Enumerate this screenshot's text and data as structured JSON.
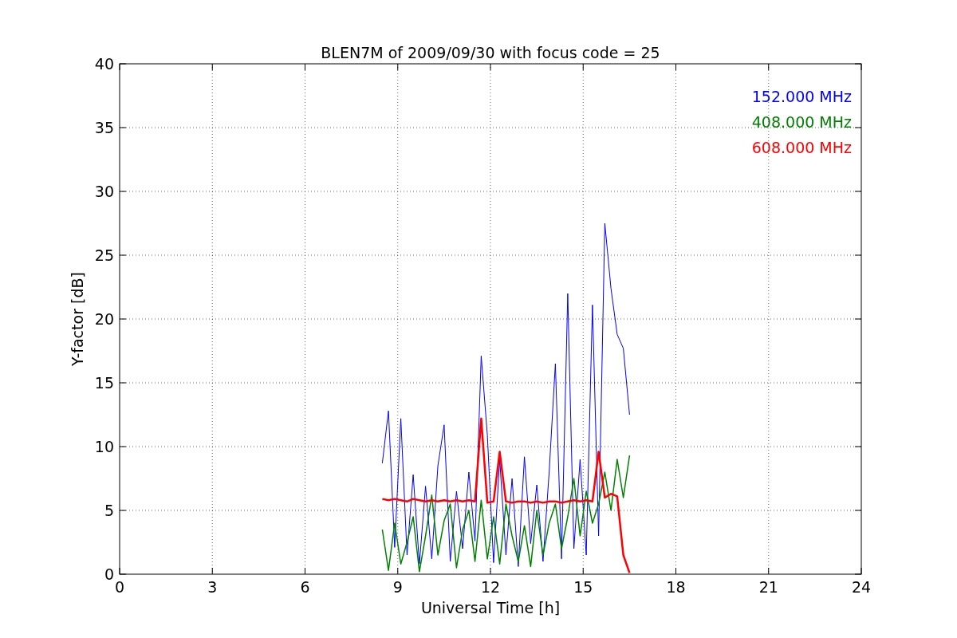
{
  "figure": {
    "chart_data": {
      "type": "line",
      "grid": true,
      "title": "BLEN7M of 2009/09/30 with focus code = 25",
      "xlabel": "Universal Time [h]",
      "ylabel": "Y-factor [dB]",
      "xlim": [
        0,
        24
      ],
      "ylim": [
        0,
        40
      ],
      "xticks": [
        0,
        3,
        6,
        9,
        12,
        15,
        18,
        21,
        24
      ],
      "yticks": [
        0,
        5,
        10,
        15,
        20,
        25,
        30,
        35,
        40
      ],
      "x": [
        8.5,
        8.7,
        8.9,
        9.1,
        9.3,
        9.5,
        9.7,
        9.9,
        10.1,
        10.3,
        10.5,
        10.7,
        10.9,
        11.1,
        11.3,
        11.5,
        11.7,
        11.9,
        12.1,
        12.3,
        12.5,
        12.7,
        12.9,
        13.1,
        13.3,
        13.5,
        13.7,
        13.9,
        14.1,
        14.3,
        14.5,
        14.7,
        14.9,
        15.1,
        15.3,
        15.5,
        15.7,
        15.9,
        16.1,
        16.3,
        16.5
      ],
      "series": [
        {
          "name": "152.000 MHz",
          "color": "#0000ff",
          "values": [
            8.7,
            12.8,
            2.1,
            12.2,
            1.5,
            7.8,
            0.8,
            6.9,
            1.2,
            8.5,
            11.7,
            1.0,
            6.5,
            2.0,
            8.0,
            2.6,
            17.1,
            10.9,
            0.9,
            9.0,
            1.5,
            7.5,
            0.6,
            9.2,
            2.4,
            7.0,
            1.0,
            8.0,
            16.5,
            1.2,
            22.0,
            2.0,
            9.0,
            1.5,
            21.1,
            3.0,
            27.5,
            22.4,
            18.8,
            17.7,
            12.5
          ]
        },
        {
          "name": "408.000 MHz",
          "color": "#008000",
          "values": [
            3.5,
            0.3,
            4.0,
            0.8,
            2.5,
            4.5,
            0.2,
            3.0,
            6.2,
            1.5,
            4.2,
            5.5,
            0.5,
            3.5,
            5.0,
            1.0,
            5.8,
            1.2,
            4.5,
            0.8,
            5.5,
            3.0,
            1.0,
            3.8,
            0.6,
            5.0,
            1.5,
            4.0,
            5.5,
            2.0,
            4.5,
            7.5,
            3.0,
            6.5,
            4.0,
            5.5,
            8.0,
            5.0,
            9.0,
            6.0,
            9.3
          ]
        },
        {
          "name": "608.000 MHz",
          "color": "#ff0000",
          "values": [
            5.9,
            5.8,
            5.9,
            5.8,
            5.7,
            5.9,
            5.8,
            5.7,
            5.8,
            5.7,
            5.8,
            5.7,
            5.8,
            5.7,
            5.8,
            5.7,
            12.2,
            5.6,
            5.7,
            9.6,
            5.7,
            5.6,
            5.7,
            5.7,
            5.6,
            5.7,
            5.6,
            5.7,
            5.7,
            5.6,
            5.7,
            5.8,
            5.7,
            5.8,
            5.7,
            9.6,
            6.0,
            6.3,
            6.1,
            1.5,
            0.1
          ]
        }
      ]
    }
  }
}
